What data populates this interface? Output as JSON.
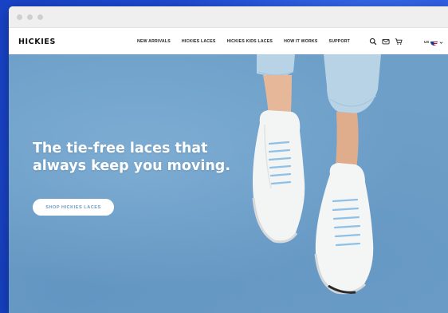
{
  "browser": {
    "window_dots": 3
  },
  "nav": {
    "logo": "HICKIES",
    "menu": [
      "NEW ARRIVALS",
      "HICKIES LACES",
      "HICKIES KIDS LACES",
      "HOW IT WORKS",
      "SUPPORT"
    ],
    "icons": [
      "search-icon",
      "mail-icon",
      "cart-icon"
    ],
    "locale": "US"
  },
  "hero": {
    "headline_line1": "The tie-free laces that",
    "headline_line2": "always keep you moving.",
    "cta_label": "SHOP HICKIES LACES"
  },
  "colors": {
    "background_blue": "#1e4fd6",
    "hero_blue": "#6d9fc8",
    "cta_text": "#6a9bc7",
    "lace_blue": "#8fc0e6"
  }
}
